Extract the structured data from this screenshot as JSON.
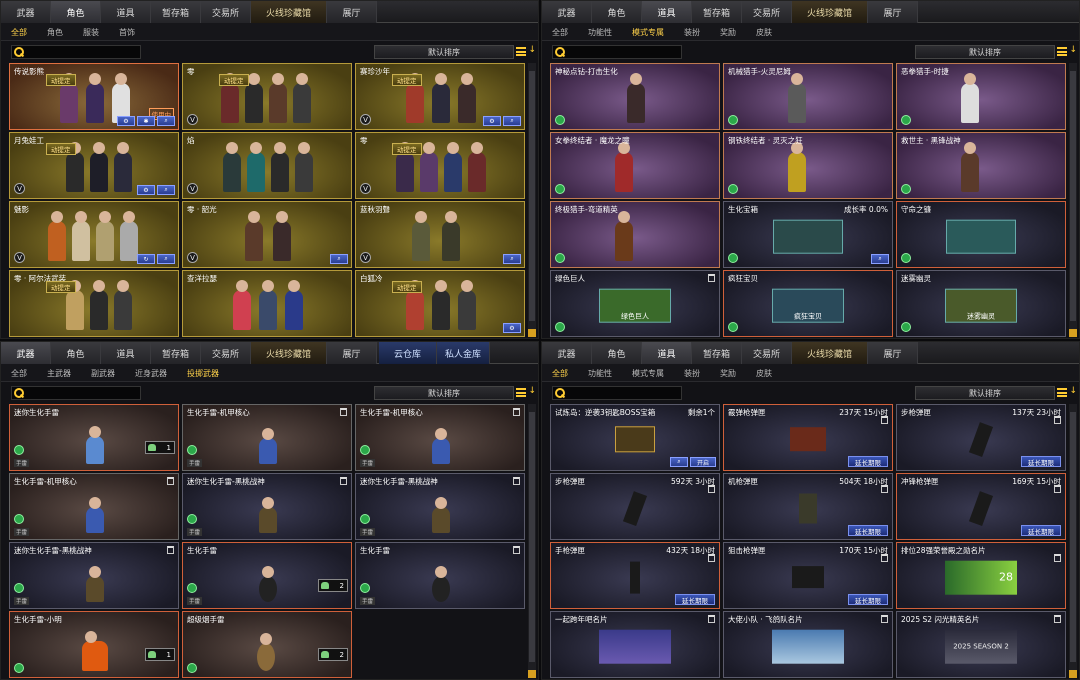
{
  "tabs": [
    "武器",
    "角色",
    "道具",
    "暂存箱",
    "交易所",
    "火线珍藏馆",
    "展厅"
  ],
  "p1": {
    "active": 1,
    "sub": [
      "全部",
      "角色",
      "服装",
      "首饰"
    ],
    "sort": "默认排序",
    "cards": [
      {
        "n": "传说影熊",
        "badge": "动提定",
        "r": "使用中"
      },
      {
        "n": "零",
        "badge": "动提定"
      },
      {
        "n": "赛珍沙年",
        "badge": "动提定"
      },
      {
        "n": "月兔娃工",
        "badge": "动提定"
      },
      {
        "n": "焰"
      },
      {
        "n": "零",
        "badge": "动提定"
      },
      {
        "n": "魅影"
      },
      {
        "n": "零 · 韶光"
      },
      {
        "n": "蓝秋羽聲"
      },
      {
        "n": "零 · 阿尔法武装",
        "badge": "动提定"
      },
      {
        "n": "查洋拉瑟"
      },
      {
        "n": "白狐冷",
        "badge": "动提定"
      }
    ]
  },
  "p2": {
    "active": 2,
    "sub": [
      "全部",
      "功能性",
      "模式专属",
      "装扮",
      "奖励",
      "皮肤"
    ],
    "sort": "默认排序",
    "cards": [
      {
        "n": "神秘点钻-打击生化"
      },
      {
        "n": "机械猎手-火灵尼姆"
      },
      {
        "n": "恶拳猎手-时捷"
      },
      {
        "n": "女拳终结者 · 魔龙之瞳"
      },
      {
        "n": "钢铁终结者 · 灵灭之狂"
      },
      {
        "n": "救世主 · 黑锋战神"
      },
      {
        "n": "终极猎手-弯道精英"
      },
      {
        "n": "生化宝箱",
        "r": "成长率 0.0%"
      },
      {
        "n": "守命之镰"
      },
      {
        "n": "绿色巨人",
        "img": "绿色巨人"
      },
      {
        "n": "疯狂宝贝",
        "img": "疯狂宝贝"
      },
      {
        "n": "迷雾幽灵",
        "img": "迷雾幽灵"
      }
    ]
  },
  "p3": {
    "tabs_extra": [
      "云仓库",
      "私人金库"
    ],
    "sub": [
      "全部",
      "主武器",
      "副武器",
      "近身武器",
      "投掷武器"
    ],
    "active_sub": 4,
    "sort": "默认排序",
    "cards": [
      {
        "n": "迷你生化手雷",
        "q": "1"
      },
      {
        "n": "生化手雷-机甲核心"
      },
      {
        "n": "生化手雷-机甲核心"
      },
      {
        "n": "生化手雷-机甲核心"
      },
      {
        "n": "迷你生化手雷-黑桃战神"
      },
      {
        "n": "迷你生化手雷-黑桃战神"
      },
      {
        "n": "迷你生化手雷-黑桃战神"
      },
      {
        "n": "生化手雷",
        "q": "2"
      },
      {
        "n": "生化手雷"
      },
      {
        "n": "生化手雷-小明",
        "q": "1"
      },
      {
        "n": "超级烟手雷",
        "q": "2"
      }
    ],
    "tag": "手雷"
  },
  "p4": {
    "active": 1,
    "sub": [
      "全部",
      "功能性",
      "模式专属",
      "装扮",
      "奖励",
      "皮肤"
    ],
    "sort": "默认排序",
    "cards": [
      {
        "n": "试炼岛：逆袭3钥匙BOSS宝箱",
        "r": "剩余1个",
        "b1": "开启"
      },
      {
        "n": "霰弹枪弹匣",
        "r": "237天 15小时",
        "b": "延长期限"
      },
      {
        "n": "步枪弹匣",
        "r": "137天 23小时",
        "b": "延长期限"
      },
      {
        "n": "步枪弹匣",
        "r": "592天 3小时"
      },
      {
        "n": "机枪弹匣",
        "r": "504天 18小时",
        "b": "延长期限"
      },
      {
        "n": "冲锋枪弹匣",
        "r": "169天 15小时",
        "b": "延长期限"
      },
      {
        "n": "手枪弹匣",
        "r": "432天 18小时",
        "b": "延长期限"
      },
      {
        "n": "狙击枪弹匣",
        "r": "170天 15小时",
        "b": "延长期限"
      },
      {
        "n": "排位28强荣誉殿之勋名片",
        "img": "28"
      },
      {
        "n": "一起跨年吧名片"
      },
      {
        "n": "大佬小队 · 飞鸽队名片"
      },
      {
        "n": "2025 S2 闪光精英名片",
        "img": "2025 SEASON 2"
      }
    ]
  }
}
